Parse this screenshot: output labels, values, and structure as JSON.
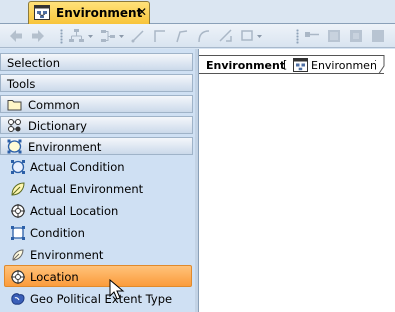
{
  "tab": {
    "title": "Environment",
    "close_glyph": "✕"
  },
  "toolbar": {
    "buttons": [
      "back-arrow-icon",
      "forward-arrow-icon",
      "tree-layout-icon",
      "hierarchy-layout-icon",
      "connector-icon",
      "rectilinear-path-icon",
      "oblique-path-icon",
      "bezier-path-icon",
      "align-icon",
      "layout-options-icon",
      "grid-icon",
      "zoom-icon"
    ]
  },
  "palette": {
    "sections": [
      {
        "label": "Selection"
      },
      {
        "label": "Tools"
      },
      {
        "label": "Common",
        "icon": "folder-icon"
      },
      {
        "label": "Dictionary",
        "icon": "dictionary-icon"
      },
      {
        "label": "Environment",
        "icon": "environment-icon"
      }
    ],
    "items": [
      {
        "label": "Actual Condition",
        "icon": "actual-condition-icon"
      },
      {
        "label": "Actual Environment",
        "icon": "actual-environment-icon"
      },
      {
        "label": "Actual Location",
        "icon": "actual-location-icon"
      },
      {
        "label": "Condition",
        "icon": "condition-icon"
      },
      {
        "label": "Environment",
        "icon": "environment-leaf-icon"
      },
      {
        "label": "Location",
        "icon": "location-icon",
        "selected": true
      },
      {
        "label": "Geo Political Extent Type",
        "icon": "geo-political-icon"
      }
    ]
  },
  "diagram": {
    "frame_name": "Environment",
    "open_bracket": "[",
    "diagram_type": "Environment",
    "close_bracket": "]"
  },
  "colors": {
    "tab_active": "#f8c43a",
    "selection": "#fb9c3c",
    "palette_bg": "#cfe0f3"
  }
}
